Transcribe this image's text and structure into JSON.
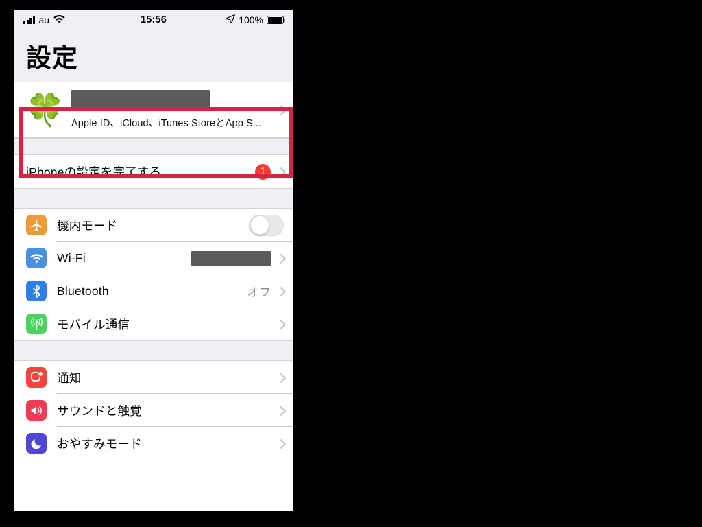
{
  "status_bar": {
    "carrier": "au",
    "time": "15:56",
    "battery_percent": "100%",
    "signal_icon": "signal-bars-icon",
    "wifi_icon": "wifi-icon",
    "location_icon": "location-arrow-icon",
    "battery_icon": "battery-full-icon"
  },
  "header": {
    "title": "設定"
  },
  "apple_id": {
    "avatar_icon": "four-leaf-clover-avatar",
    "name_redacted": true,
    "subtitle": "Apple ID、iCloud、iTunes StoreとApp S...",
    "chevron_icon": "chevron-right-icon",
    "highlight_color": "#d32644"
  },
  "setup_section": {
    "rows": [
      {
        "label": "iPhoneの設定を完了する",
        "badge": "1",
        "badge_color": "#ff3b30",
        "chevron_icon": "chevron-right-icon"
      }
    ]
  },
  "connectivity_section": {
    "rows": [
      {
        "label": "機内モード",
        "icon": "airplane-icon",
        "icon_color": "#f09a37",
        "control": "toggle",
        "toggle_on": false
      },
      {
        "label": "Wi-Fi",
        "icon": "wifi-icon",
        "icon_color": "#4a90e2",
        "control": "redacted-value",
        "chevron_icon": "chevron-right-icon"
      },
      {
        "label": "Bluetooth",
        "icon": "bluetooth-icon",
        "icon_color": "#2d7ff0",
        "value": "オフ",
        "chevron_icon": "chevron-right-icon"
      },
      {
        "label": "モバイル通信",
        "icon": "cellular-antenna-icon",
        "icon_color": "#4cd25f",
        "chevron_icon": "chevron-right-icon"
      }
    ]
  },
  "notifications_section": {
    "rows": [
      {
        "label": "通知",
        "icon": "notifications-icon",
        "icon_color": "#f2453d",
        "chevron_icon": "chevron-right-icon"
      },
      {
        "label": "サウンドと触覚",
        "icon": "sounds-haptics-icon",
        "icon_color": "#f03b52",
        "chevron_icon": "chevron-right-icon"
      },
      {
        "label": "おやすみモード",
        "icon": "do-not-disturb-moon-icon",
        "icon_color": "#4f46d6",
        "chevron_icon": "chevron-right-icon"
      }
    ]
  }
}
